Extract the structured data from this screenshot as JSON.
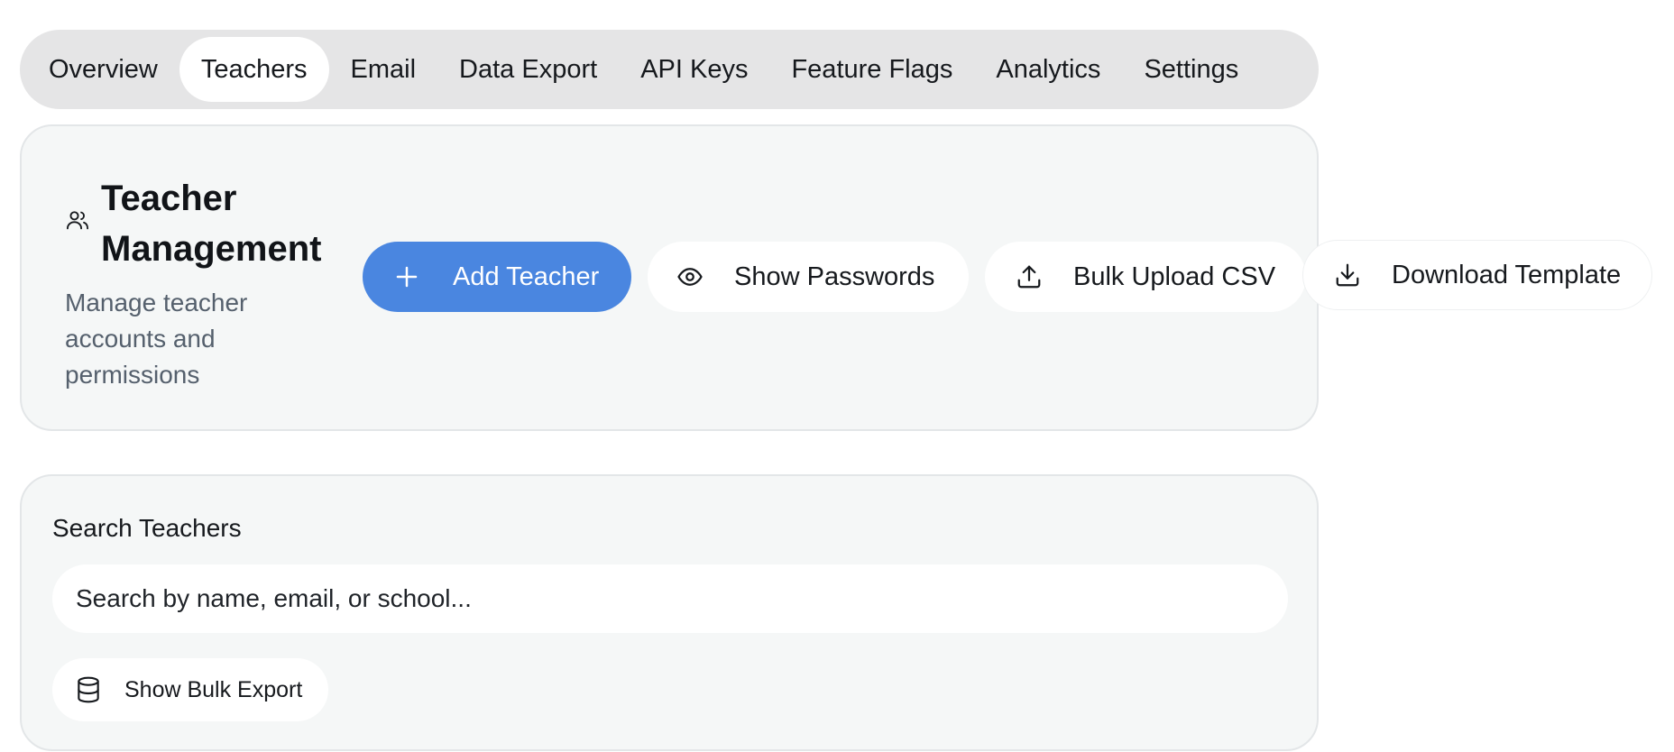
{
  "tabs": [
    {
      "label": "Overview",
      "active": false
    },
    {
      "label": "Teachers",
      "active": true
    },
    {
      "label": "Email",
      "active": false
    },
    {
      "label": "Data Export",
      "active": false
    },
    {
      "label": "API Keys",
      "active": false
    },
    {
      "label": "Feature Flags",
      "active": false
    },
    {
      "label": "Analytics",
      "active": false
    },
    {
      "label": "Settings",
      "active": false
    }
  ],
  "header": {
    "icon": "users-icon",
    "title": "Teacher Management",
    "subtitle": "Manage teacher accounts and permissions",
    "buttons": {
      "add": {
        "label": "Add Teacher",
        "icon": "plus-icon"
      },
      "passwords": {
        "label": "Show Passwords",
        "icon": "eye-icon"
      },
      "bulk_upload": {
        "label": "Bulk Upload CSV",
        "icon": "upload-icon"
      },
      "template": {
        "label": "Download Template",
        "icon": "download-icon"
      }
    }
  },
  "search": {
    "label": "Search Teachers",
    "placeholder": "Search by name, email, or school...",
    "value": "",
    "export_button": {
      "label": "Show Bulk Export",
      "icon": "database-icon"
    }
  },
  "colors": {
    "accent": "#4a86e0",
    "tabbar_bg": "#e5e5e6",
    "card_bg": "#f5f7f7",
    "muted_text": "#55606d"
  }
}
